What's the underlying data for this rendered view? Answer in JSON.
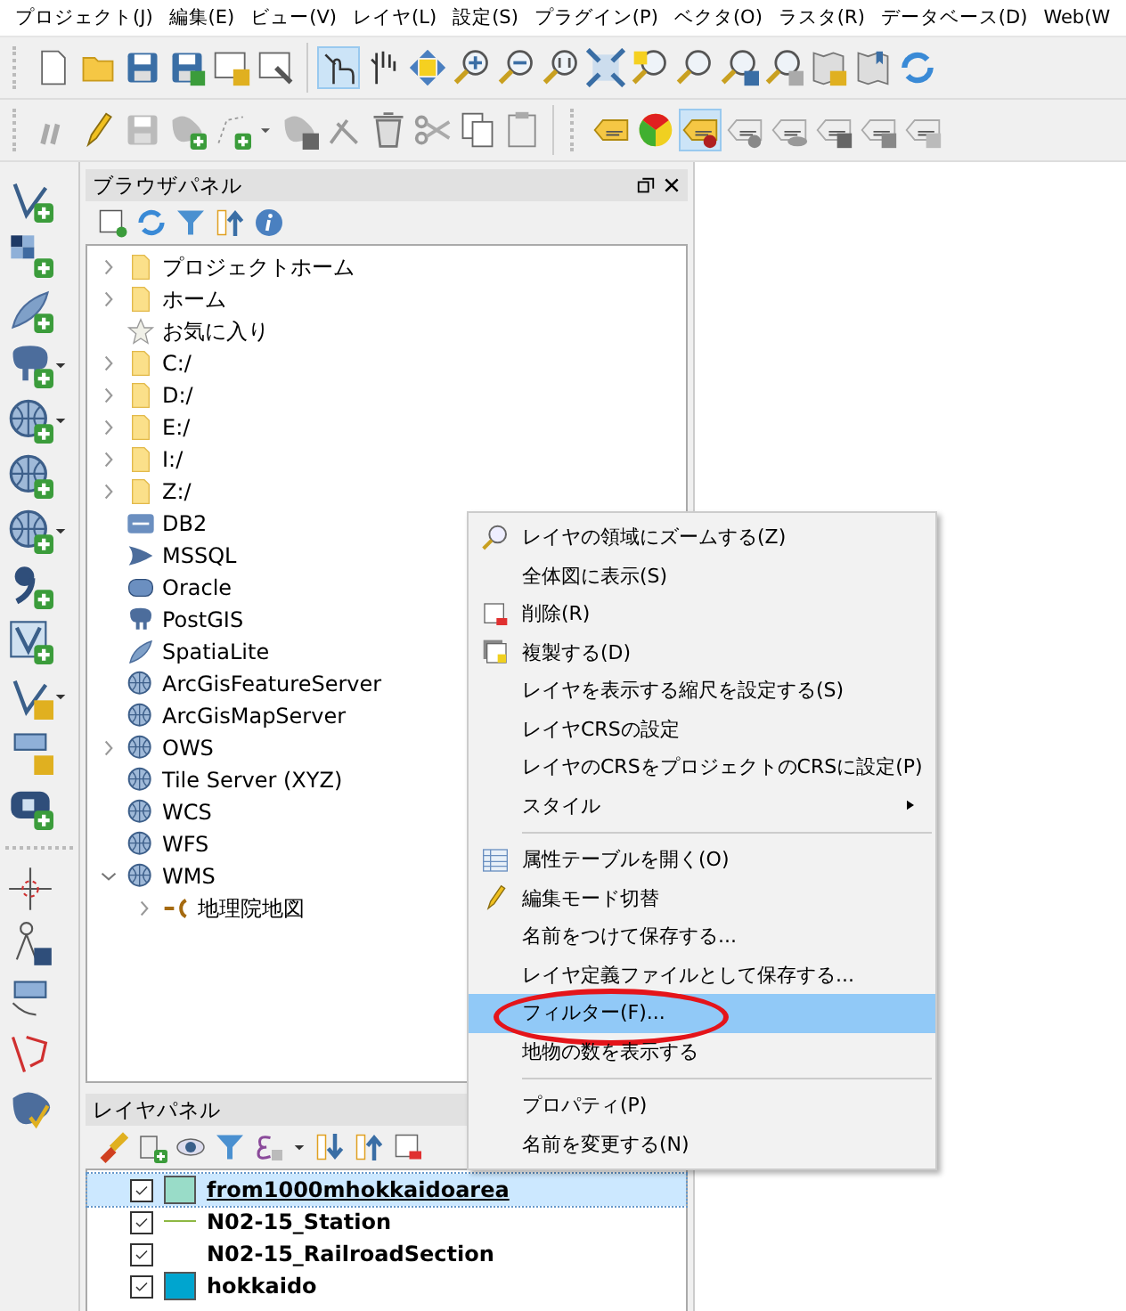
{
  "menu_bar": [
    "プロジェクト(J)",
    "編集(E)",
    "ビュー(V)",
    "レイヤ(L)",
    "設定(S)",
    "プラグイン(P)",
    "ベクタ(O)",
    "ラスタ(R)",
    "データベース(D)",
    "Web(W"
  ],
  "browser_panel": {
    "title": "ブラウザパネル",
    "items": [
      {
        "label": "プロジェクトホーム",
        "expanded": false
      },
      {
        "label": "ホーム",
        "expanded": false
      },
      {
        "label": "お気に入り"
      },
      {
        "label": "C:/",
        "expanded": false
      },
      {
        "label": "D:/",
        "expanded": false
      },
      {
        "label": "E:/",
        "expanded": false
      },
      {
        "label": "I:/",
        "expanded": false
      },
      {
        "label": "Z:/",
        "expanded": false
      },
      {
        "label": "DB2"
      },
      {
        "label": "MSSQL"
      },
      {
        "label": "Oracle"
      },
      {
        "label": "PostGIS"
      },
      {
        "label": "SpatiaLite"
      },
      {
        "label": "ArcGisFeatureServer"
      },
      {
        "label": "ArcGisMapServer"
      },
      {
        "label": "OWS",
        "expanded": false
      },
      {
        "label": "Tile Server (XYZ)"
      },
      {
        "label": "WCS"
      },
      {
        "label": "WFS"
      },
      {
        "label": "WMS",
        "expanded": true,
        "children": [
          {
            "label": "地理院地図",
            "expanded": false
          }
        ]
      }
    ]
  },
  "layer_panel": {
    "title": "レイヤパネル",
    "layers": [
      {
        "name": "from1000mhokkaidoarea",
        "checked": true,
        "selected": true,
        "kind": "fill",
        "color": "#99dcc8"
      },
      {
        "name": "N02-15_Station",
        "checked": true,
        "selected": false,
        "kind": "line",
        "color": "#8db843"
      },
      {
        "name": "N02-15_RailroadSection",
        "checked": true,
        "selected": false,
        "kind": "none"
      },
      {
        "name": "hokkaido",
        "checked": true,
        "selected": false,
        "kind": "fill",
        "color": "#00a5cf"
      }
    ]
  },
  "context_menu": {
    "items": [
      {
        "kind": "item",
        "label": "レイヤの領域にズームする(Z)",
        "selected": false
      },
      {
        "kind": "item",
        "label": "全体図に表示(S)",
        "selected": false
      },
      {
        "kind": "item",
        "label": "削除(R)",
        "selected": false
      },
      {
        "kind": "item",
        "label": "複製する(D)",
        "selected": false
      },
      {
        "kind": "item",
        "label": "レイヤを表示する縮尺を設定する(S)",
        "selected": false
      },
      {
        "kind": "item",
        "label": "レイヤCRSの設定",
        "selected": false
      },
      {
        "kind": "item",
        "label": "レイヤのCRSをプロジェクトのCRSに設定(P)",
        "selected": false
      },
      {
        "kind": "submenu",
        "label": "スタイル",
        "selected": false
      },
      {
        "kind": "separator"
      },
      {
        "kind": "item",
        "label": "属性テーブルを開く(O)",
        "selected": false
      },
      {
        "kind": "item",
        "label": "編集モード切替",
        "selected": false
      },
      {
        "kind": "item",
        "label": "名前をつけて保存する...",
        "selected": false
      },
      {
        "kind": "item",
        "label": "レイヤ定義ファイルとして保存する...",
        "selected": false
      },
      {
        "kind": "item",
        "label": "フィルター(F)...",
        "selected": true
      },
      {
        "kind": "item",
        "label": "地物の数を表示する",
        "selected": false
      },
      {
        "kind": "separator"
      },
      {
        "kind": "item",
        "label": "プロパティ(P)",
        "selected": false
      },
      {
        "kind": "item",
        "label": "名前を変更する(N)",
        "selected": false
      }
    ]
  }
}
